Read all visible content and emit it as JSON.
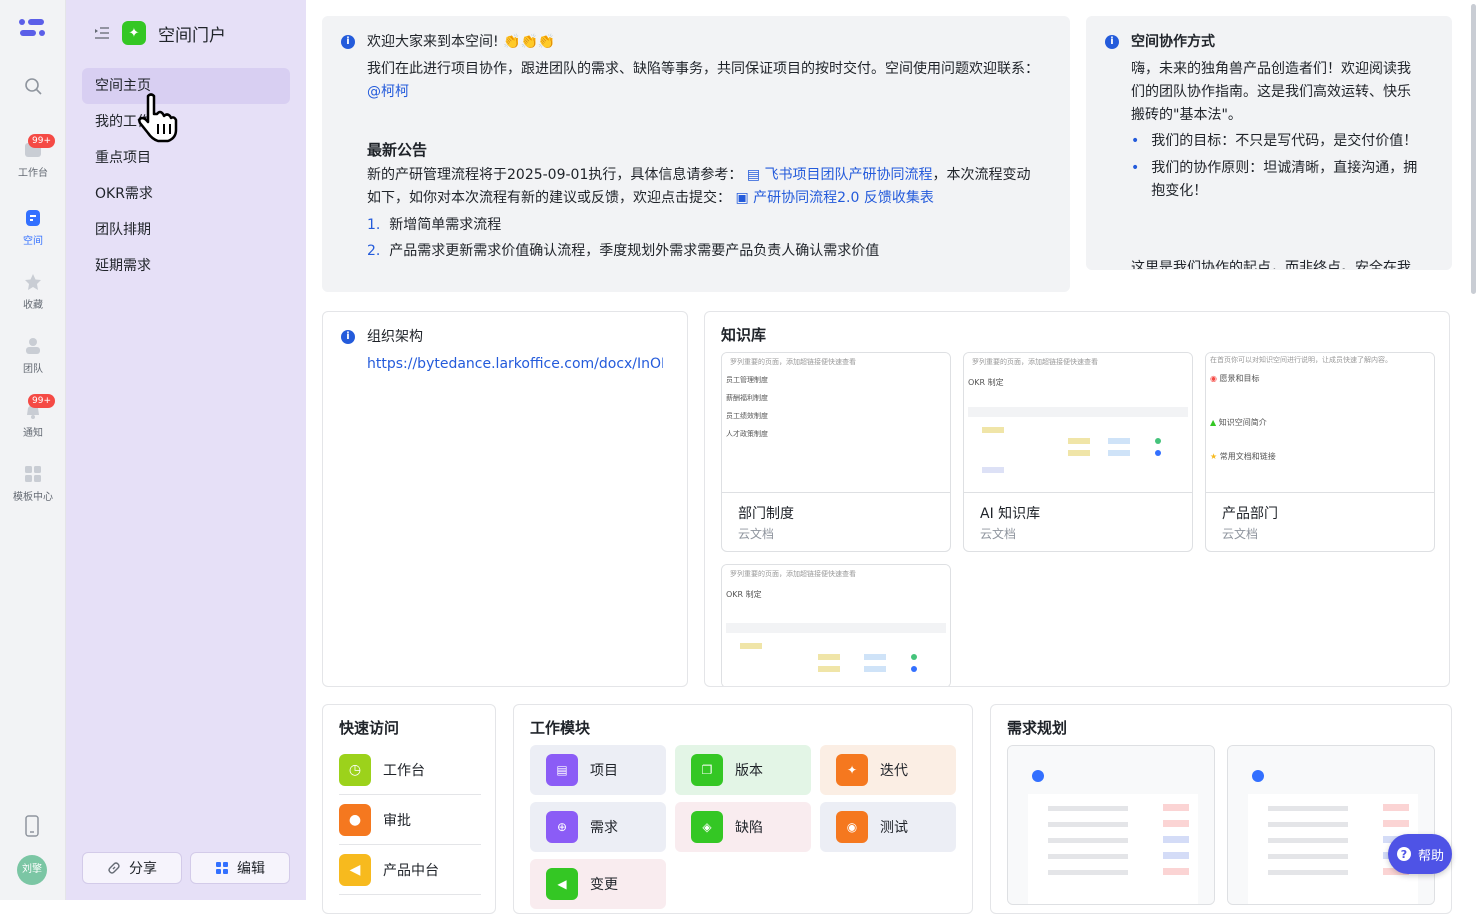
{
  "rail": {
    "items": [
      {
        "label": "工作台",
        "badge": "99+"
      },
      {
        "label": "空间"
      },
      {
        "label": "收藏"
      },
      {
        "label": "团队"
      },
      {
        "label": "通知",
        "badge": "99+"
      },
      {
        "label": "模板中心"
      }
    ],
    "avatar_text": "刘擎"
  },
  "sidebar": {
    "title": "空间门户",
    "items": [
      "空间主页",
      "我的工作",
      "重点项目",
      "OKR需求",
      "团队排期",
      "延期需求"
    ],
    "share_label": "分享",
    "edit_label": "编辑"
  },
  "welcome": {
    "line1": "欢迎大家来到本空间! 👏👏👏",
    "line2": "我们在此进行项目协作，跟进团队的需求、缺陷等事务，共同保证项目的按时交付。空间使用问题欢迎联系：",
    "mention": "@柯柯",
    "notice_title": "最新公告",
    "notice_p1": "新的产研管理流程将于2025-09-01执行，具体信息请参考：",
    "notice_link1": "飞书项目团队产研协同流程",
    "notice_p2": "，本次流程变动",
    "notice_p3": "如下，如你对本次流程有新的建议或反馈，欢迎点击提交：",
    "notice_link2": "产研协同流程2.0 反馈收集表",
    "list": [
      "新增简单需求流程",
      "产品需求更新需求价值确认流程，季度规划外需求需要产品负责人确认需求价值"
    ]
  },
  "collab": {
    "title": "空间协作方式",
    "p1": "嗨，未来的独角兽产品创造者们！欢迎阅读我们的团队协作指南。这是我们高效运转、快乐搬砖的\"基本法\"。",
    "b1": "我们的目标：不只是写代码，是交付价值！",
    "b2": "我们的协作原则：坦诚清晰，直接沟通，拥抱变化！",
    "p2": "这里是我们协作的起点，而非终点。安全在我"
  },
  "org": {
    "title": "组织架构",
    "url": "https://bytedance.larkoffice.com/docx/InOFc"
  },
  "kb": {
    "title": "知识库",
    "docs": [
      {
        "name": "部门制度",
        "type": "云文档",
        "preview_head": "罗列重要的页面，添加超链接便快速查看",
        "lines": [
          "员工管理制度",
          "薪酬福利制度",
          "员工绩效制度",
          "人才政策制度"
        ]
      },
      {
        "name": "AI 知识库",
        "type": "云文档",
        "preview_head": "罗列重要的页面，添加超链接便快速查看",
        "lines": [
          "OKR 制定"
        ]
      },
      {
        "name": "产品部门",
        "type": "云文档",
        "preview_head": "在首页你可以对知识空间进行说明，让成员快速了解内容。",
        "lines": [
          "愿景和目标",
          "知识空间简介",
          "常用文档和链接"
        ]
      },
      {
        "name": "",
        "type": "",
        "preview_head": "罗列重要的页面，添加超链接便快速查看",
        "lines": [
          "OKR 制定"
        ]
      }
    ]
  },
  "quick": {
    "title": "快速访问",
    "items": [
      {
        "label": "工作台",
        "color": "#9cd21b"
      },
      {
        "label": "审批",
        "color": "#f5781f"
      },
      {
        "label": "产品中台",
        "color": "#f7ba1e"
      }
    ]
  },
  "modules": {
    "title": "工作模块",
    "items": [
      {
        "label": "项目",
        "color": "#8b5cf6",
        "bg": "#eceef5"
      },
      {
        "label": "版本",
        "color": "#34c724",
        "bg": "#e3f5e6"
      },
      {
        "label": "迭代",
        "color": "#f5781f",
        "bg": "#fbeee4"
      },
      {
        "label": "需求",
        "color": "#8b5cf6",
        "bg": "#eceef5"
      },
      {
        "label": "缺陷",
        "color": "#34c724",
        "bg": "#f9ecef"
      },
      {
        "label": "测试",
        "color": "#f5781f",
        "bg": "#eceef5"
      },
      {
        "label": "变更",
        "color": "#34c724",
        "bg": "#f9ecef"
      }
    ]
  },
  "plan": {
    "title": "需求规划"
  },
  "help_label": "帮助"
}
